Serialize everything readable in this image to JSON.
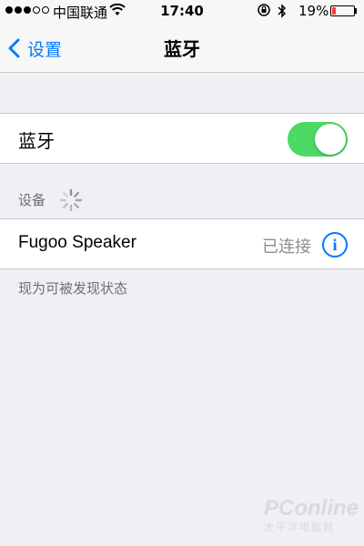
{
  "status_bar": {
    "carrier": "中国联通",
    "time": "17:40",
    "battery": "19%",
    "signal_bars_filled": 3,
    "signal_bars_total": 5,
    "battery_level": 0.19
  },
  "nav": {
    "back_label": "设置",
    "title": "蓝牙"
  },
  "bluetooth": {
    "label": "蓝牙",
    "enabled": true
  },
  "devices": {
    "header": "设备",
    "items": [
      {
        "name": "Fugoo Speaker",
        "status": "已连接",
        "info_icon": "info-icon"
      }
    ],
    "discoverable_note": "现为可被发现状态"
  },
  "watermark": {
    "brand": "PConline",
    "sub": "太平洋电脑网"
  },
  "colors": {
    "accent": "#007aff",
    "toggle_on": "#4cd964",
    "battery_low": "#ff3b30",
    "background": "#efeff4"
  }
}
